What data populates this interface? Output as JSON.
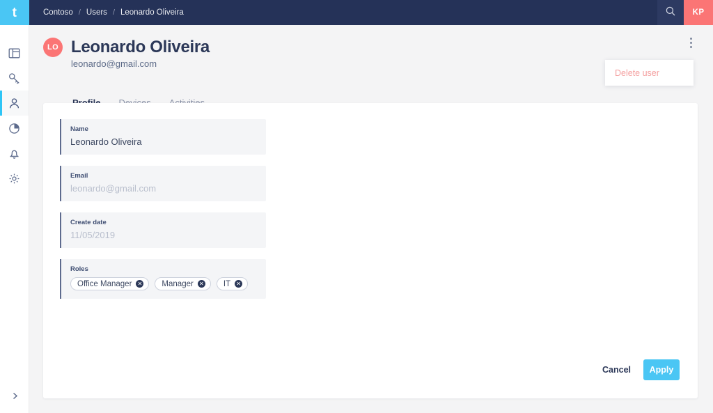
{
  "brand": {
    "logo_text": "t",
    "logo_color": "#4ac6f4"
  },
  "colors": {
    "topbar": "#253258",
    "accent": "#2ec5f6",
    "apply": "#4ac6f4",
    "avatar": "#fb7575",
    "danger_text": "#f4a0a0",
    "page_bg": "#f4f4f5"
  },
  "topbar": {
    "breadcrumb": [
      {
        "label": "Contoso"
      },
      {
        "label": "Users"
      },
      {
        "label": "Leonardo Oliveira"
      }
    ],
    "separator": "/",
    "search_icon": "search-icon",
    "user_initials": "KP"
  },
  "sidebar": {
    "items": [
      {
        "name": "dashboard",
        "icon": "layout-panel-icon",
        "active": false
      },
      {
        "name": "keys",
        "icon": "key-icon",
        "active": false
      },
      {
        "name": "users",
        "icon": "person-icon",
        "active": true
      },
      {
        "name": "reports",
        "icon": "pie-chart-icon",
        "active": false
      },
      {
        "name": "notifications",
        "icon": "bell-icon",
        "active": false
      },
      {
        "name": "settings",
        "icon": "gear-icon",
        "active": false
      }
    ],
    "expand_icon": "chevron-right-icon"
  },
  "user": {
    "initials": "LO",
    "name": "Leonardo Oliveira",
    "email": "leonardo@gmail.com"
  },
  "tabs": [
    {
      "label": "Profile",
      "active": true
    },
    {
      "label": "Devices",
      "active": false
    },
    {
      "label": "Activities",
      "active": false
    }
  ],
  "overflow_menu": {
    "trigger_icon": "kebab-menu-icon",
    "items": [
      {
        "label": "Delete user"
      }
    ]
  },
  "form": {
    "fields": [
      {
        "label": "Name",
        "value": "Leonardo Oliveira",
        "disabled": false
      },
      {
        "label": "Email",
        "value": "leonardo@gmail.com",
        "disabled": true
      },
      {
        "label": "Create date",
        "value": "11/05/2019",
        "disabled": true
      }
    ],
    "roles": {
      "label": "Roles",
      "chips": [
        {
          "label": "Office Manager",
          "remove_icon": "close-icon"
        },
        {
          "label": "Manager",
          "remove_icon": "close-icon"
        },
        {
          "label": "IT",
          "remove_icon": "close-icon"
        }
      ]
    },
    "actions": {
      "cancel_label": "Cancel",
      "apply_label": "Apply"
    }
  }
}
